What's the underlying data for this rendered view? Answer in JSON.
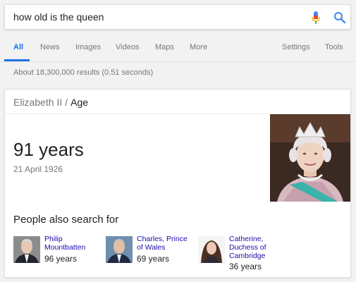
{
  "search": {
    "query": "how old is the queen"
  },
  "tabs": [
    {
      "label": "All",
      "active": true
    },
    {
      "label": "News"
    },
    {
      "label": "Images"
    },
    {
      "label": "Videos"
    },
    {
      "label": "Maps"
    },
    {
      "label": "More"
    },
    {
      "label": "Settings"
    },
    {
      "label": "Tools"
    }
  ],
  "result_stats": "About 18,300,000 results (0.51 seconds)",
  "card": {
    "breadcrumb_entity": "Elizabeth II",
    "breadcrumb_separator": "/",
    "breadcrumb_attribute": "Age",
    "age_value": "91 years",
    "birth_date": "21 April 1926",
    "people_title": "People also search for",
    "people": [
      {
        "name": "Philip Mountbatten",
        "age": "96 years"
      },
      {
        "name": "Charles, Prince of Wales",
        "age": "69 years"
      },
      {
        "name": "Catherine, Duchess of Cambridge",
        "age": "36 years"
      }
    ]
  },
  "colors": {
    "accent_blue": "#1a73e8",
    "link_blue": "#1a0dab",
    "mic_red": "#ea4335"
  },
  "icons": [
    "mic-icon",
    "search-icon"
  ]
}
